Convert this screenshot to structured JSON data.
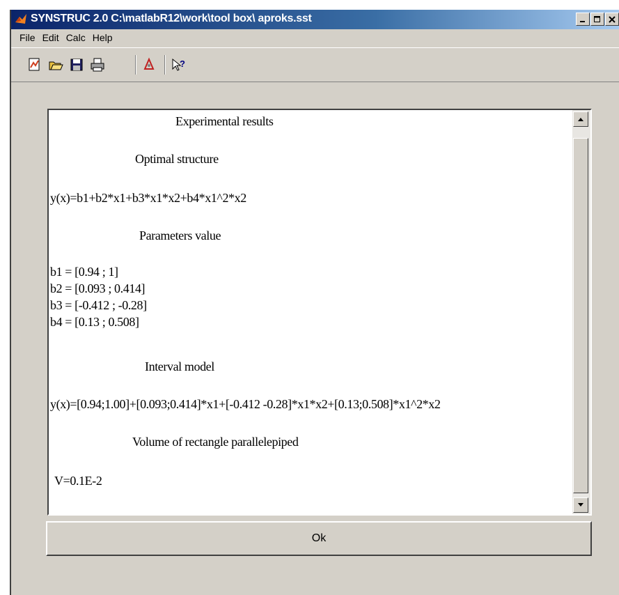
{
  "window": {
    "title": "SYNSTRUC 2.0  C:\\matlabR12\\work\\tool box\\ aproks.sst"
  },
  "menu": [
    "File",
    "Edit",
    "Calc",
    "Help"
  ],
  "toolbar": {
    "icons": [
      "new-figure-icon",
      "open-folder-icon",
      "save-icon",
      "print-icon",
      "tool-icon",
      "help-cursor-icon"
    ]
  },
  "results": {
    "heading": "Experimental results",
    "optimal_structure_heading": "Optimal structure",
    "structure_formula": "y(x)=b1+b2*x1+b3*x1*x2+b4*x1^2*x2",
    "parameters_heading": "Parameters value",
    "parameters": [
      "b1 = [0.94 ; 1]",
      "b2 = [0.093 ; 0.414]",
      "b3 = [-0.412 ; -0.28]",
      "b4 = [0.13 ; 0.508]"
    ],
    "interval_model_heading": "Interval model",
    "interval_model_formula": "y(x)=[0.94;1.00]+[0.093;0.414]*x1+[-0.412 -0.28]*x1*x2+[0.13;0.508]*x1^2*x2",
    "volume_heading": "Volume of rectangle parallelepiped",
    "volume_value": "V=0.1E-2"
  },
  "ok_button": "Ok"
}
